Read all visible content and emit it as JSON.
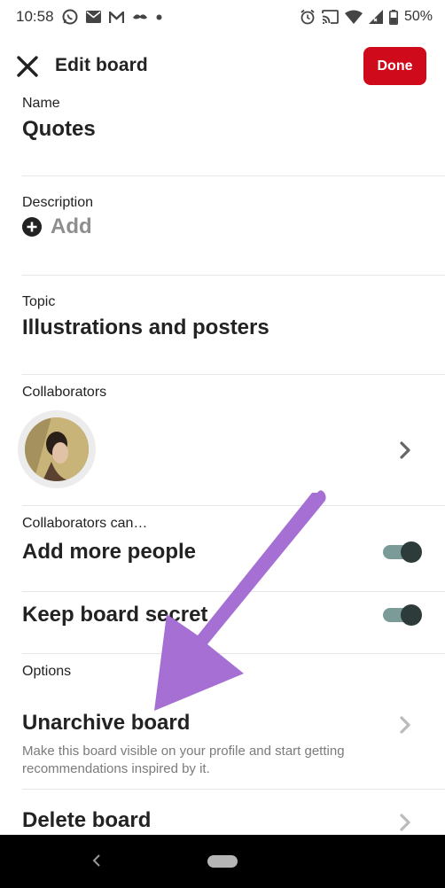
{
  "status_bar": {
    "time": "10:58",
    "left_icons": [
      "whatsapp-icon",
      "mail-icon",
      "gmail-icon",
      "mustache-icon",
      "dot-icon"
    ],
    "right_icons": [
      "alarm-icon",
      "cast-icon",
      "wifi-icon",
      "signal-icon",
      "battery-icon"
    ],
    "battery": "50%"
  },
  "header": {
    "title": "Edit board",
    "done_label": "Done"
  },
  "fields": {
    "name_label": "Name",
    "name_value": "Quotes",
    "description_label": "Description",
    "description_add": "Add",
    "topic_label": "Topic",
    "topic_value": "Illustrations and posters",
    "collaborators_label": "Collaborators",
    "collaborators_can_label": "Collaborators can…",
    "add_people_label": "Add more people",
    "keep_secret_label": "Keep board secret",
    "options_label": "Options",
    "unarchive_label": "Unarchive board",
    "unarchive_desc": "Make this board visible on your profile and start getting recommendations inspired by it.",
    "delete_label": "Delete board"
  },
  "toggles": {
    "add_people_on": true,
    "keep_secret_on": true
  },
  "colors": {
    "done_button": "#cf0a1b",
    "toggle_track": "#7a9b97",
    "toggle_thumb": "#2d3b3a",
    "annotation_arrow": "#a56fd4"
  }
}
